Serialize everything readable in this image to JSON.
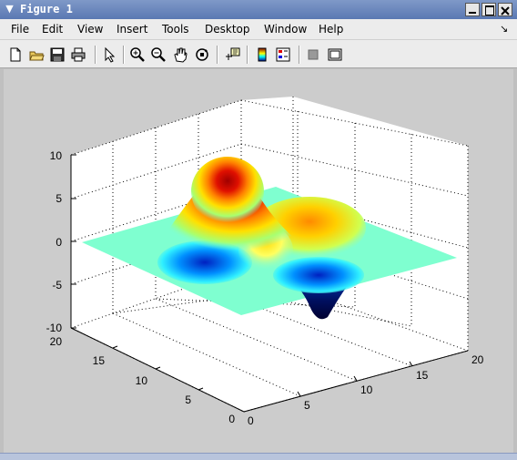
{
  "window": {
    "title": "Figure 1",
    "app_icon": "chevron-down-icon"
  },
  "menu": [
    {
      "label": "File"
    },
    {
      "label": "Edit"
    },
    {
      "label": "View"
    },
    {
      "label": "Insert"
    },
    {
      "label": "Tools"
    },
    {
      "label": "Desktop"
    },
    {
      "label": "Window"
    },
    {
      "label": "Help"
    }
  ],
  "toolbar_icons": [
    "new-file-icon",
    "open-folder-icon",
    "save-icon",
    "print-icon",
    "pointer-icon",
    "zoom-in-icon",
    "zoom-out-icon",
    "pan-hand-icon",
    "rotate-3d-icon",
    "data-cursor-icon",
    "colorbar-icon",
    "legend-icon",
    "hide-plot-tools-icon",
    "show-plot-tools-icon"
  ],
  "plot": {
    "z_ticks": [
      "10",
      "5",
      "0",
      "-5",
      "-10"
    ],
    "y_ticks": [
      "20",
      "15",
      "10",
      "5",
      "0"
    ],
    "x_ticks": [
      "0",
      "5",
      "10",
      "15",
      "20"
    ],
    "colormap": "jet",
    "grid": "dotted"
  }
}
